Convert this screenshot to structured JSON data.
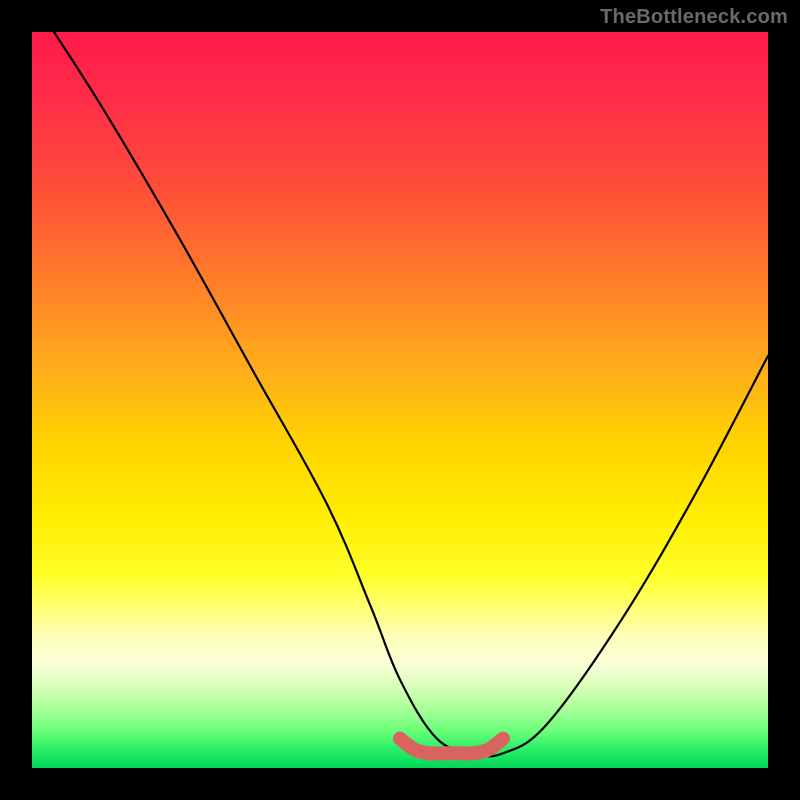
{
  "watermark": "TheBottleneck.com",
  "chart_data": {
    "type": "line",
    "title": "",
    "xlabel": "",
    "ylabel": "",
    "xlim": [
      0,
      100
    ],
    "ylim": [
      0,
      100
    ],
    "grid": false,
    "legend": false,
    "annotations": [],
    "series": [
      {
        "name": "bottleneck-curve",
        "color": "#000000",
        "x": [
          3,
          10,
          20,
          30,
          40,
          46,
          50,
          55,
          60,
          64,
          70,
          80,
          90,
          100
        ],
        "values": [
          100,
          89,
          72,
          54,
          36,
          22,
          12,
          4,
          2,
          2,
          6,
          20,
          37,
          56
        ]
      },
      {
        "name": "optimal-range-marker",
        "color": "#d9645f",
        "x": [
          50,
          52,
          54,
          56,
          58,
          60,
          62,
          64
        ],
        "values": [
          4,
          2.5,
          2,
          2,
          2,
          2,
          2.5,
          4
        ]
      }
    ],
    "gradient_stops": [
      {
        "pos": 0.0,
        "color": "#ff1a4a"
      },
      {
        "pos": 0.2,
        "color": "#ff4a3a"
      },
      {
        "pos": 0.46,
        "color": "#ffae1a"
      },
      {
        "pos": 0.66,
        "color": "#ffee00"
      },
      {
        "pos": 0.86,
        "color": "#f8ffd8"
      },
      {
        "pos": 1.0,
        "color": "#00d858"
      }
    ]
  }
}
